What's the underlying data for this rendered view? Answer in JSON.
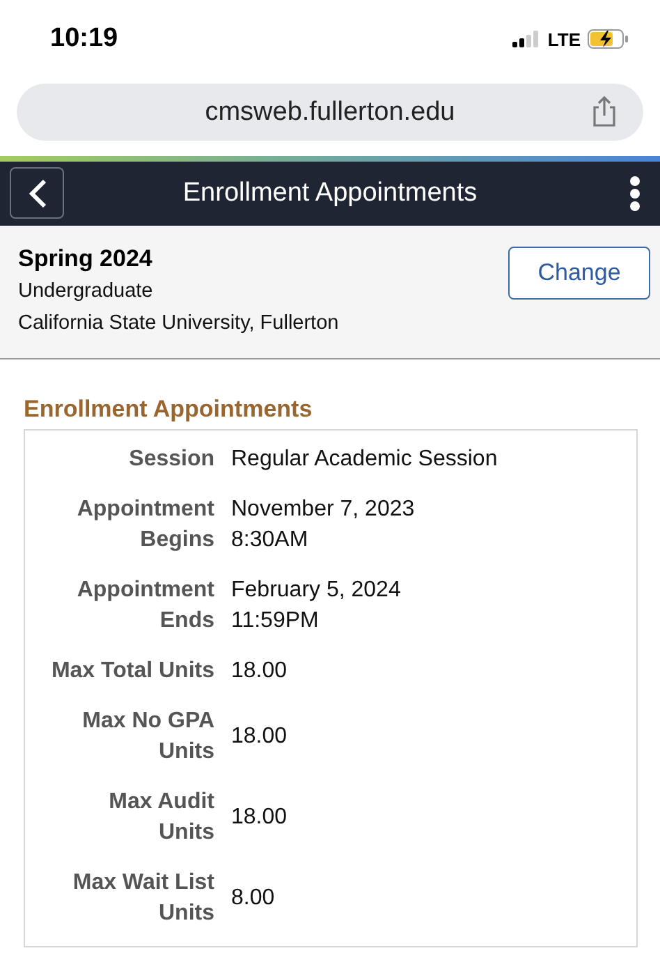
{
  "status_bar": {
    "time": "10:19",
    "network": "LTE"
  },
  "address_bar": {
    "url": "cmsweb.fullerton.edu"
  },
  "header": {
    "title": "Enrollment Appointments"
  },
  "term": {
    "name": "Spring 2024",
    "career": "Undergraduate",
    "institution": "California State University, Fullerton",
    "button": "Change"
  },
  "section": {
    "title": "Enrollment Appointments",
    "fields": [
      {
        "label": "Session",
        "value": "Regular Academic Session"
      },
      {
        "label": "Appointment\nBegins",
        "value": "November 7, 2023\n8:30AM"
      },
      {
        "label": "Appointment\nEnds",
        "value": "February 5, 2024\n11:59PM"
      },
      {
        "label": "Max Total Units",
        "value": "18.00"
      },
      {
        "label": "Max No GPA\nUnits",
        "value": "18.00"
      },
      {
        "label": "Max Audit\nUnits",
        "value": "18.00"
      },
      {
        "label": "Max Wait List\nUnits",
        "value": "8.00"
      }
    ]
  }
}
